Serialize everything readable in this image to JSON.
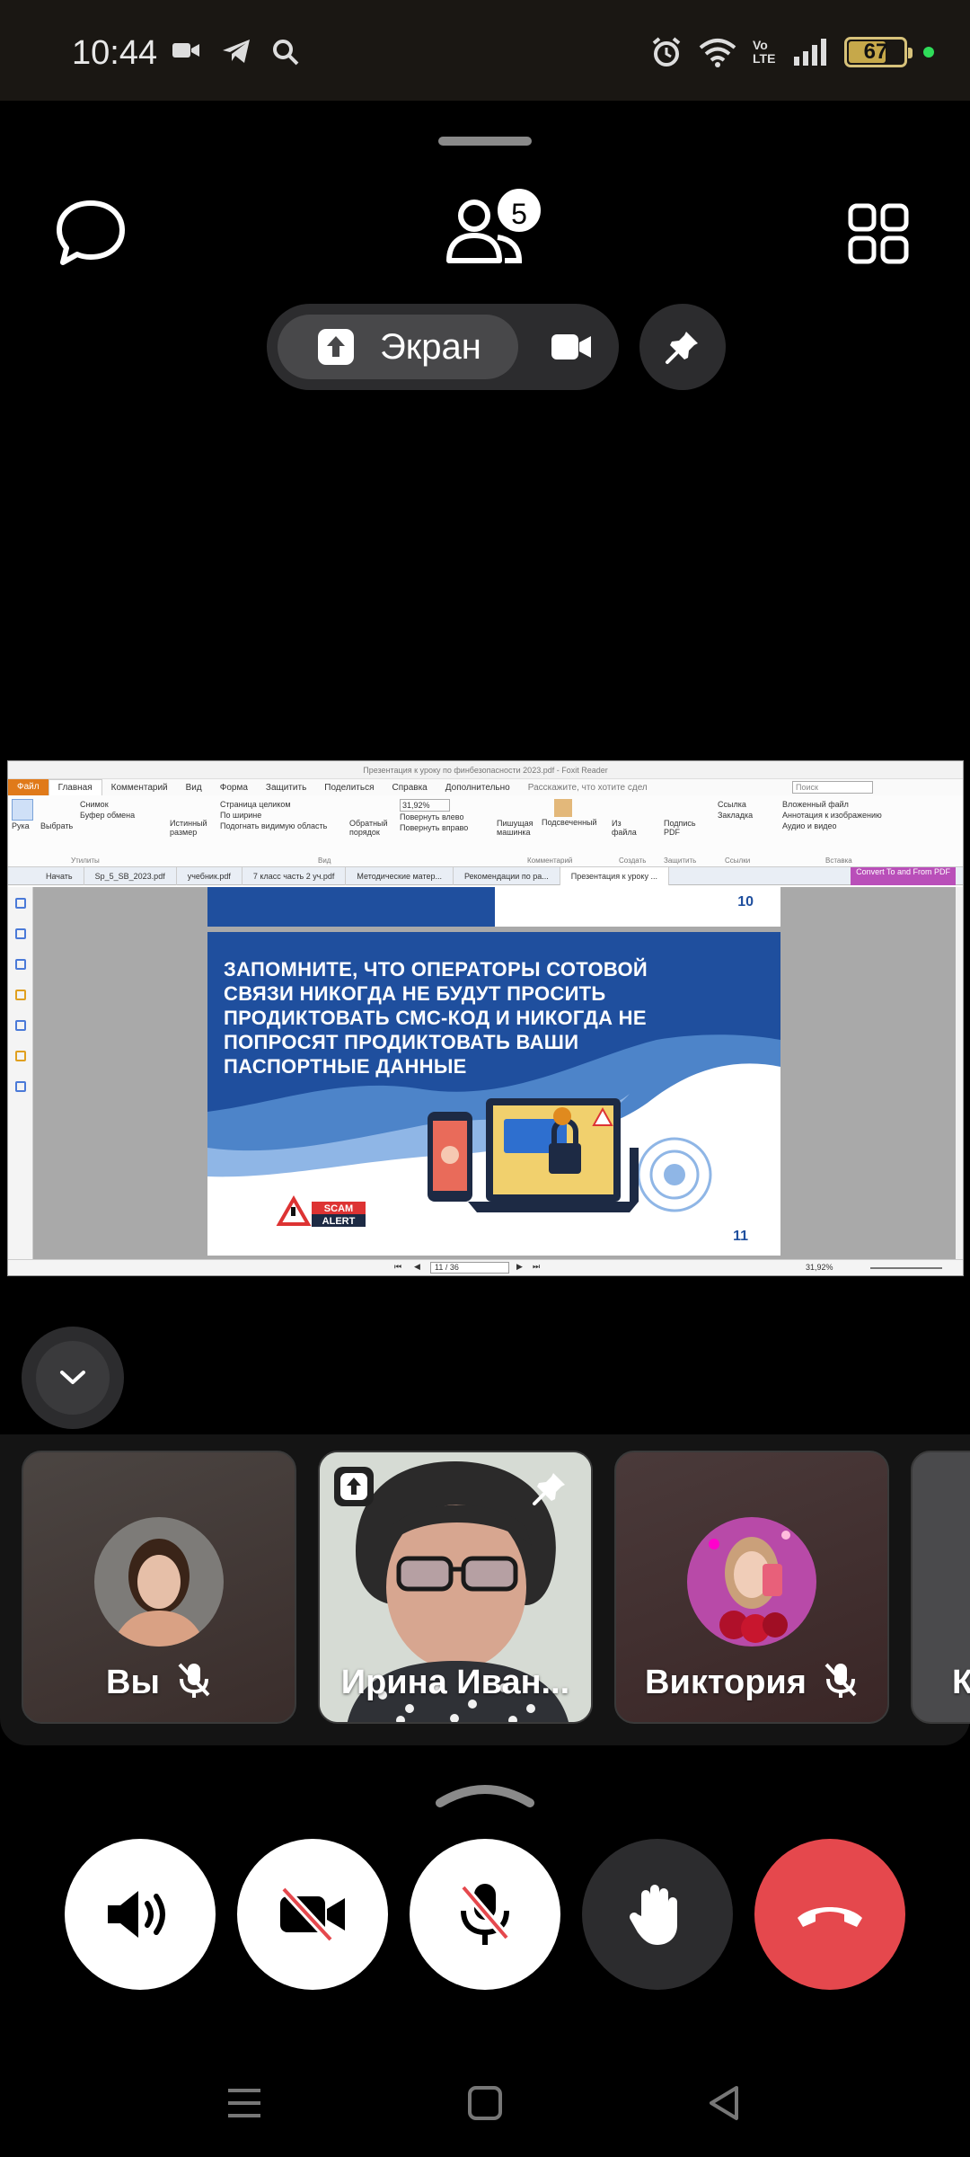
{
  "status_bar": {
    "time": "10:44",
    "left_icons": [
      "video-icon",
      "telegram-icon",
      "search-icon"
    ],
    "right_icons": [
      "alarm-icon",
      "wifi-icon",
      "volte-icon",
      "signal-icon"
    ],
    "volte_label": "Vo LTE",
    "battery": "67"
  },
  "call_header": {
    "participants_count": "5",
    "screen_label": "Экран"
  },
  "shared_screen": {
    "window_title": "Презентация к уроку по финбезопасности 2023.pdf - Foxit Reader",
    "menu": [
      "Файл",
      "Главная",
      "Комментарий",
      "Вид",
      "Форма",
      "Защитить",
      "Поделиться",
      "Справка",
      "Дополнительно"
    ],
    "tell_me": "Расскажите, что хотите сдел",
    "search_placeholder": "Поиск",
    "ribbon": {
      "hand": "Рука",
      "select": "Выбрать",
      "snapshot": "Снимок",
      "clipboard": "Буфер обмена",
      "utilities": "Утилиты",
      "actual_size": "Истинный размер",
      "fit_page": "Страница целиком",
      "fit_width": "По ширине",
      "fit_visible": "Подогнать видимую область",
      "reverse": "Обратный порядок",
      "zoom": "31,92%",
      "rotate_left": "Повернуть влево",
      "rotate_right": "Повернуть вправо",
      "view": "Вид",
      "typewriter": "Пишущая машинка",
      "highlight": "Подсвеченный",
      "comment": "Комментарий",
      "from_file": "Из файла",
      "create": "Создать",
      "sign_pdf": "Подпись PDF",
      "protect": "Защитить",
      "link": "Ссылка",
      "bookmark": "Закладка",
      "links": "Ссылки",
      "attached_file": "Вложенный файл",
      "image_annotation": "Аннотация к изображению",
      "audio_video": "Аудио и видео",
      "insert": "Вставка"
    },
    "tabs": [
      "Начать",
      "Sp_5_SB_2023.pdf",
      "учебник.pdf",
      "7 класс часть 2 уч.pdf",
      "Методические матер...",
      "Рекомендации по ра...",
      "Презентация к уроку ..."
    ],
    "convert_label": "Convert To and From PDF",
    "page_10_number": "10",
    "slide_text": "ЗАПОМНИТЕ, ЧТО ОПЕРАТОРЫ СОТОВОЙ СВЯЗИ НИКОГДА НЕ БУДУТ ПРОСИТЬ ПРОДИКТОВАТЬ СМС-КОД И НИКОГДА НЕ ПОПРОСЯТ ПРОДИКТОВАТЬ ВАШИ ПАСПОРТНЫЕ ДАННЫЕ",
    "scam_label": "SCAM",
    "alert_label": "ALERT",
    "page_11_number": "11",
    "page_indicator": "11 / 36",
    "zoom_status": "31,92%"
  },
  "participants": [
    {
      "name": "Вы",
      "muted": true
    },
    {
      "name": "Ирина Иван...",
      "sharing": true,
      "pinned": true
    },
    {
      "name": "Виктория",
      "muted": true
    },
    {
      "name": "К"
    }
  ],
  "controls": [
    "speaker-icon",
    "camera-off-icon",
    "mic-off-icon",
    "raise-hand-icon",
    "end-call-icon"
  ],
  "colors": {
    "end_call": "#e5484d",
    "slide_blue": "#1f4f9e",
    "foxit_orange": "#e07a1a"
  }
}
